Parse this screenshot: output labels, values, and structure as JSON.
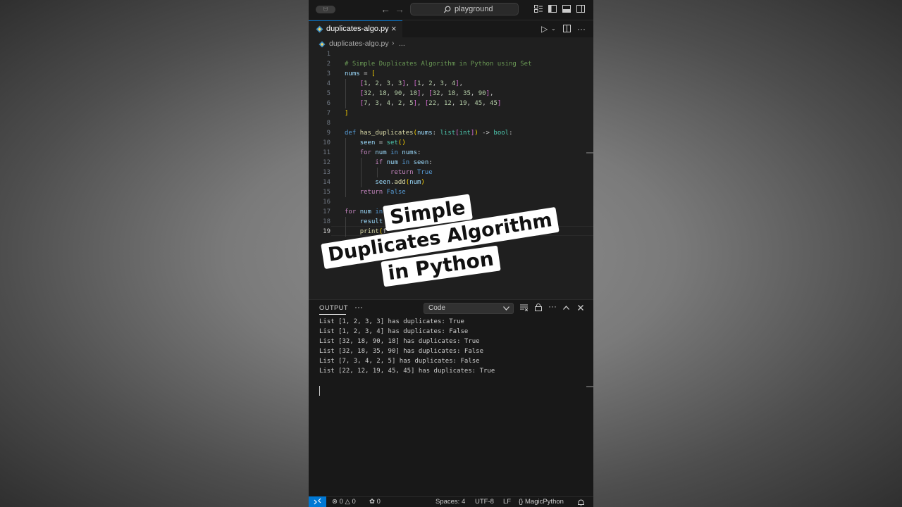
{
  "titlebar": {
    "badge": "ᗢ",
    "search_label": "playground"
  },
  "tab": {
    "label": "duplicates-algo.py",
    "close": "×"
  },
  "breadcrumb": {
    "file": "duplicates-algo.py",
    "separator": "›",
    "more": "..."
  },
  "editor": {
    "line_numbers": [
      "1",
      "2",
      "3",
      "4",
      "5",
      "6",
      "7",
      "8",
      "9",
      "10",
      "11",
      "12",
      "13",
      "14",
      "15",
      "16",
      "17",
      "18",
      "19"
    ],
    "comment": "# Simple Duplicates Algorithm in Python using Set"
  },
  "overlay_caption": {
    "line1": "Simple",
    "line2": "Duplicates Algorithm",
    "line3": "in Python"
  },
  "panel": {
    "title": "OUTPUT",
    "more": "···",
    "selected_channel": "Code",
    "output_lines": [
      "List [1, 2, 3, 3] has duplicates: True",
      "List [1, 2, 3, 4] has duplicates: False",
      "List [32, 18, 90, 18] has duplicates: True",
      "List [32, 18, 35, 90] has duplicates: False",
      "List [7, 3, 4, 2, 5] has duplicates: False",
      "List [22, 12, 19, 45, 45] has duplicates: True"
    ]
  },
  "statusbar": {
    "errors": "0",
    "warnings": "0",
    "ports": "0",
    "spaces": "Spaces: 4",
    "encoding": "UTF-8",
    "eol": "LF",
    "language_brace": "{}",
    "language": "MagicPython"
  },
  "colors": {
    "accent": "#0078d4",
    "editor_bg": "#1f1f1f",
    "chrome_bg": "#181818"
  }
}
